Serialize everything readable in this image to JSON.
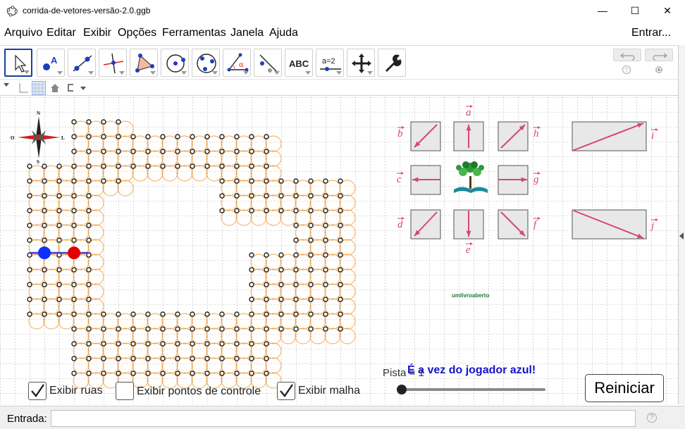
{
  "window": {
    "title": "corrida-de-vetores-versão-2.0.ggb",
    "minimize": "—",
    "maximize": "☐",
    "close": "✕"
  },
  "menu": {
    "items": [
      "Arquivo",
      "Editar",
      "Exibir",
      "Opções",
      "Ferramentas",
      "Janela",
      "Ajuda"
    ],
    "signin": "Entrar..."
  },
  "toolbar": {
    "tools": [
      "move",
      "point",
      "line",
      "perpendicular",
      "polygon",
      "circle",
      "conic",
      "angle",
      "reflect",
      "text",
      "slider",
      "move-graphics",
      "tools"
    ],
    "text_tool_label": "ABC",
    "slider_tool_label": "a=2"
  },
  "vectors": {
    "a": "a",
    "b": "b",
    "c": "c",
    "d": "d",
    "e": "e",
    "f": "f",
    "g": "g",
    "h": "h",
    "i": "i",
    "j": "j"
  },
  "compass": {
    "n": "N",
    "s": "S",
    "l": "L",
    "o": "O"
  },
  "logo_text": "umlivroaberto",
  "turn_message": "É a vez do jogador azul!",
  "checkboxes": [
    {
      "label": "Exibir ruas",
      "checked": true
    },
    {
      "label": "Exibir pontos de controle",
      "checked": false
    },
    {
      "label": "Exibir malha",
      "checked": true
    }
  ],
  "slider": {
    "label": "Pista = 1",
    "value": 1
  },
  "reset_button": "Reiniciar",
  "input_bar": {
    "label": "Entrada:",
    "value": ""
  },
  "colors": {
    "vector": "#d6457e",
    "track": "#f5a34a",
    "blue_player": "#0a2fff",
    "red_player": "#e00000",
    "message": "#1414c8"
  }
}
